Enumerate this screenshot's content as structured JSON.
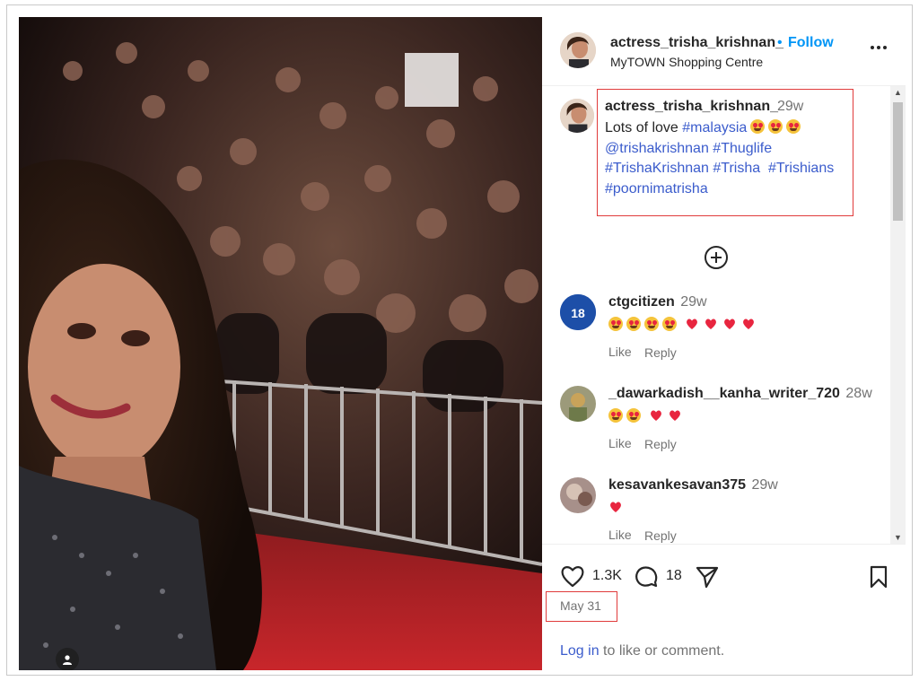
{
  "header": {
    "username": "actress_trisha_krishnan_",
    "dot": "•",
    "follow_label": "Follow",
    "location": "MyTOWN Shopping Centre",
    "more_icon": "more-options-icon"
  },
  "caption": {
    "username": "actress_trisha_krishnan_",
    "time": "29w",
    "text_lead": "Lots of love",
    "tag_malaysia": "#malaysia",
    "mention": "@trishakrishnan",
    "tag_thuglife": "#Thuglife",
    "tag_trishakrishnan": "#TrishaKrishnan",
    "tag_trisha": "#Trisha",
    "tag_trishians": "#Trishians",
    "tag_poornimatrisha": "#poornimatrisha"
  },
  "load_more_icon": "plus-circle-icon",
  "comments": [
    {
      "user": "ctgcitizen",
      "time": "29w",
      "emojis": "😍😍😍😍❤️❤️❤️❤️",
      "like_label": "Like",
      "reply_label": "Reply",
      "badge": "18"
    },
    {
      "user": "_dawarkadish__kanha_writer_720",
      "time": "28w",
      "emojis": "🥰😍❤️❤️",
      "like_label": "Like",
      "reply_label": "Reply"
    },
    {
      "user": "kesavankesavan375",
      "time": "29w",
      "emojis": "❤️",
      "like_label": "Like",
      "reply_label": "Reply"
    }
  ],
  "actions": {
    "like_count": "1.3K",
    "comment_count": "18",
    "date": "May 31",
    "login_link": "Log in",
    "login_text": " to like or comment."
  },
  "colors": {
    "link_blue": "#3b5ccc",
    "follow_blue": "#0095f6",
    "highlight_red": "#e03b3b",
    "heart_red": "#e8253f"
  }
}
